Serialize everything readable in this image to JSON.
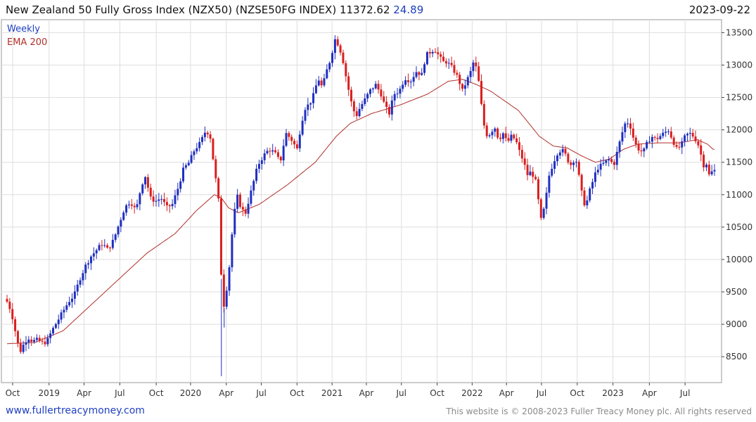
{
  "header": {
    "title": "New Zealand 50 Fully Gross Index (NZX50) (NZSE50FG INDEX) 11372.62",
    "change": "24.89",
    "date": "2023-09-22"
  },
  "footer": {
    "site": "www.fullertreacymoney.com",
    "copyright": "This website is © 2008-2023 Fuller Treacy Money plc. All rights reserved"
  },
  "colors": {
    "up": "#1f2fbf",
    "down": "#d91f1f",
    "ema": "#b0302a",
    "grid": "#dedede",
    "axis": "#444444"
  },
  "chart_data": {
    "type": "candlestick",
    "legend": [
      {
        "name": "Weekly",
        "color": "#1f3fc0"
      },
      {
        "name": "EMA 200",
        "color": "#b0302a"
      }
    ],
    "legend_position": "top-left",
    "grid": true,
    "y_axis_side": "right",
    "ylim": [
      8100,
      13700
    ],
    "yticks": [
      8500,
      9000,
      9500,
      10000,
      10500,
      11000,
      11500,
      12000,
      12500,
      13000,
      13500
    ],
    "xlim": [
      0,
      1010
    ],
    "xticks": [
      {
        "label": "Oct",
        "pos": 8
      },
      {
        "label": "2019",
        "pos": 60
      },
      {
        "label": "Apr",
        "pos": 110
      },
      {
        "label": "Jul",
        "pos": 161
      },
      {
        "label": "Oct",
        "pos": 213
      },
      {
        "label": "2020",
        "pos": 262
      },
      {
        "label": "Apr",
        "pos": 313
      },
      {
        "label": "Jul",
        "pos": 363
      },
      {
        "label": "Oct",
        "pos": 414
      },
      {
        "label": "2021",
        "pos": 464
      },
      {
        "label": "Apr",
        "pos": 513
      },
      {
        "label": "Jul",
        "pos": 563
      },
      {
        "label": "Oct",
        "pos": 614
      },
      {
        "label": "2022",
        "pos": 664
      },
      {
        "label": "Apr",
        "pos": 713
      },
      {
        "label": "Jul",
        "pos": 763
      },
      {
        "label": "Oct",
        "pos": 814
      },
      {
        "label": "2023",
        "pos": 865
      },
      {
        "label": "Apr",
        "pos": 917
      },
      {
        "label": "Jul",
        "pos": 968
      }
    ],
    "close_anchors": [
      [
        0,
        9350
      ],
      [
        6,
        9200
      ],
      [
        12,
        8880
      ],
      [
        18,
        8560
      ],
      [
        24,
        8700
      ],
      [
        30,
        8800
      ],
      [
        36,
        8740
      ],
      [
        44,
        8760
      ],
      [
        52,
        8700
      ],
      [
        58,
        8760
      ],
      [
        64,
        8900
      ],
      [
        72,
        9050
      ],
      [
        80,
        9200
      ],
      [
        88,
        9350
      ],
      [
        96,
        9450
      ],
      [
        104,
        9700
      ],
      [
        112,
        9900
      ],
      [
        120,
        10050
      ],
      [
        128,
        10150
      ],
      [
        136,
        10250
      ],
      [
        144,
        10150
      ],
      [
        152,
        10300
      ],
      [
        160,
        10550
      ],
      [
        168,
        10800
      ],
      [
        176,
        10900
      ],
      [
        184,
        10750
      ],
      [
        192,
        11150
      ],
      [
        198,
        11300
      ],
      [
        204,
        10950
      ],
      [
        212,
        10900
      ],
      [
        220,
        10950
      ],
      [
        228,
        10800
      ],
      [
        236,
        10850
      ],
      [
        244,
        11100
      ],
      [
        252,
        11400
      ],
      [
        260,
        11500
      ],
      [
        268,
        11700
      ],
      [
        276,
        11800
      ],
      [
        284,
        12000
      ],
      [
        290,
        11900
      ],
      [
        296,
        11400
      ],
      [
        302,
        10900
      ],
      [
        306,
        9700
      ],
      [
        310,
        9250
      ],
      [
        314,
        9600
      ],
      [
        318,
        9950
      ],
      [
        322,
        10500
      ],
      [
        328,
        11000
      ],
      [
        334,
        10800
      ],
      [
        340,
        10700
      ],
      [
        346,
        10950
      ],
      [
        352,
        11200
      ],
      [
        358,
        11450
      ],
      [
        366,
        11600
      ],
      [
        374,
        11700
      ],
      [
        382,
        11650
      ],
      [
        390,
        11500
      ],
      [
        398,
        11950
      ],
      [
        406,
        11850
      ],
      [
        414,
        11700
      ],
      [
        420,
        12100
      ],
      [
        426,
        12350
      ],
      [
        432,
        12400
      ],
      [
        438,
        12550
      ],
      [
        444,
        12800
      ],
      [
        450,
        12650
      ],
      [
        456,
        12900
      ],
      [
        462,
        13100
      ],
      [
        468,
        13400
      ],
      [
        474,
        13300
      ],
      [
        480,
        13050
      ],
      [
        486,
        12700
      ],
      [
        492,
        12400
      ],
      [
        498,
        12200
      ],
      [
        504,
        12350
      ],
      [
        510,
        12450
      ],
      [
        518,
        12600
      ],
      [
        526,
        12700
      ],
      [
        534,
        12550
      ],
      [
        540,
        12350
      ],
      [
        546,
        12250
      ],
      [
        552,
        12550
      ],
      [
        560,
        12600
      ],
      [
        568,
        12800
      ],
      [
        576,
        12750
      ],
      [
        584,
        12900
      ],
      [
        592,
        12850
      ],
      [
        598,
        13150
      ],
      [
        604,
        13200
      ],
      [
        610,
        13250
      ],
      [
        616,
        13150
      ],
      [
        622,
        13050
      ],
      [
        628,
        13050
      ],
      [
        636,
        12950
      ],
      [
        644,
        12800
      ],
      [
        650,
        12600
      ],
      [
        656,
        12750
      ],
      [
        662,
        12900
      ],
      [
        666,
        13050
      ],
      [
        670,
        12950
      ],
      [
        674,
        12700
      ],
      [
        678,
        12300
      ],
      [
        682,
        12000
      ],
      [
        686,
        11900
      ],
      [
        690,
        11950
      ],
      [
        696,
        12050
      ],
      [
        702,
        11850
      ],
      [
        708,
        11950
      ],
      [
        714,
        11800
      ],
      [
        720,
        11900
      ],
      [
        726,
        11850
      ],
      [
        732,
        11650
      ],
      [
        738,
        11500
      ],
      [
        742,
        11300
      ],
      [
        748,
        11350
      ],
      [
        754,
        11250
      ],
      [
        758,
        10950
      ],
      [
        762,
        10600
      ],
      [
        766,
        10750
      ],
      [
        770,
        11000
      ],
      [
        774,
        11300
      ],
      [
        780,
        11500
      ],
      [
        786,
        11650
      ],
      [
        792,
        11700
      ],
      [
        798,
        11600
      ],
      [
        804,
        11450
      ],
      [
        810,
        11550
      ],
      [
        814,
        11500
      ],
      [
        818,
        11150
      ],
      [
        822,
        10950
      ],
      [
        826,
        10800
      ],
      [
        830,
        11000
      ],
      [
        836,
        11200
      ],
      [
        842,
        11400
      ],
      [
        848,
        11450
      ],
      [
        854,
        11500
      ],
      [
        860,
        11550
      ],
      [
        866,
        11450
      ],
      [
        872,
        11700
      ],
      [
        878,
        11950
      ],
      [
        884,
        12150
      ],
      [
        890,
        12050
      ],
      [
        896,
        11800
      ],
      [
        902,
        11700
      ],
      [
        908,
        11650
      ],
      [
        914,
        11800
      ],
      [
        920,
        11900
      ],
      [
        926,
        11850
      ],
      [
        932,
        11900
      ],
      [
        938,
        11950
      ],
      [
        944,
        12000
      ],
      [
        950,
        11850
      ],
      [
        956,
        11700
      ],
      [
        962,
        11750
      ],
      [
        968,
        11900
      ],
      [
        974,
        11950
      ],
      [
        980,
        11900
      ],
      [
        986,
        11800
      ],
      [
        990,
        11650
      ],
      [
        994,
        11450
      ],
      [
        998,
        11500
      ],
      [
        1002,
        11300
      ],
      [
        1008,
        11372
      ]
    ],
    "ema_anchors": [
      [
        0,
        8700
      ],
      [
        40,
        8720
      ],
      [
        80,
        8900
      ],
      [
        120,
        9300
      ],
      [
        160,
        9700
      ],
      [
        200,
        10100
      ],
      [
        240,
        10400
      ],
      [
        270,
        10750
      ],
      [
        296,
        11000
      ],
      [
        306,
        10950
      ],
      [
        316,
        10800
      ],
      [
        330,
        10720
      ],
      [
        360,
        10850
      ],
      [
        400,
        11150
      ],
      [
        440,
        11500
      ],
      [
        470,
        11900
      ],
      [
        490,
        12100
      ],
      [
        520,
        12250
      ],
      [
        560,
        12380
      ],
      [
        600,
        12550
      ],
      [
        630,
        12750
      ],
      [
        650,
        12780
      ],
      [
        670,
        12700
      ],
      [
        690,
        12600
      ],
      [
        730,
        12300
      ],
      [
        760,
        11900
      ],
      [
        780,
        11750
      ],
      [
        800,
        11720
      ],
      [
        820,
        11600
      ],
      [
        840,
        11500
      ],
      [
        860,
        11550
      ],
      [
        880,
        11700
      ],
      [
        900,
        11780
      ],
      [
        930,
        11800
      ],
      [
        960,
        11800
      ],
      [
        985,
        11850
      ],
      [
        1000,
        11780
      ],
      [
        1008,
        11700
      ]
    ]
  }
}
